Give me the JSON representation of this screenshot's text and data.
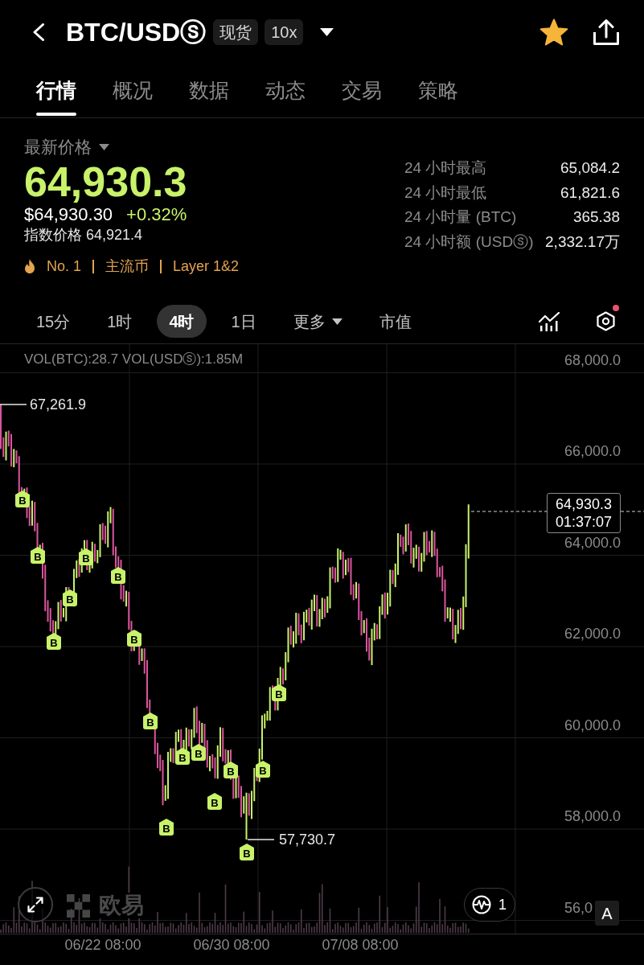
{
  "header": {
    "title": "BTC/USDⓢ",
    "badges": [
      "现货",
      "10x"
    ]
  },
  "tabs": [
    {
      "label": "行情",
      "selected": true
    },
    {
      "label": "概况",
      "selected": false
    },
    {
      "label": "数据",
      "selected": false
    },
    {
      "label": "动态",
      "selected": false
    },
    {
      "label": "交易",
      "selected": false
    },
    {
      "label": "策略",
      "selected": false
    }
  ],
  "price": {
    "label": "最新价格",
    "last": "64,930.3",
    "usd": "$64,930.30",
    "change": "+0.32%",
    "index": "指数价格 64,921.4",
    "tags": [
      "No. 1",
      "主流币",
      "Layer 1&2"
    ]
  },
  "stats": [
    {
      "label": "24 小时最高",
      "value": "65,084.2"
    },
    {
      "label": "24 小时最低",
      "value": "61,821.6"
    },
    {
      "label": "24 小时量 (BTC)",
      "value": "365.38"
    },
    {
      "label": "24 小时额 (USDⓢ)",
      "value": "2,332.17万"
    }
  ],
  "intervals": [
    {
      "label": "15分",
      "selected": false,
      "kind": "option"
    },
    {
      "label": "1时",
      "selected": false,
      "kind": "option"
    },
    {
      "label": "4时",
      "selected": true,
      "kind": "option"
    },
    {
      "label": "1日",
      "selected": false,
      "kind": "option"
    },
    {
      "label": "更多",
      "selected": false,
      "kind": "dropdown"
    },
    {
      "label": "市值",
      "selected": false,
      "kind": "option"
    }
  ],
  "chart_tools": {
    "notification_dot": true
  },
  "chart": {
    "legend": "VOL(BTC):28.7 VOL(USDⓢ):1.85M",
    "y_ticks": [
      "68,000.0",
      "66,000.0",
      "64,000.0",
      "62,000.0",
      "60,000.0",
      "58,000.0",
      "56,0"
    ],
    "x_ticks": [
      "06/22 08:00",
      "06/30 08:00",
      "07/08 08:00"
    ],
    "high": "67,261.9",
    "low": "57,730.7",
    "last_price": "64,930.3",
    "countdown": "01:37:07",
    "markers": [
      {
        "label": "B"
      },
      {
        "label": "B"
      },
      {
        "label": "B"
      },
      {
        "label": "B"
      },
      {
        "label": "B"
      },
      {
        "label": "B"
      },
      {
        "label": "B"
      },
      {
        "label": "B"
      },
      {
        "label": "B"
      },
      {
        "label": "B"
      },
      {
        "label": "B"
      },
      {
        "label": "B"
      },
      {
        "label": "B"
      },
      {
        "label": "B"
      },
      {
        "label": "B"
      },
      {
        "label": "B"
      }
    ],
    "watermark": "欧易",
    "indicator_count": "1",
    "scale_button": "A"
  }
}
